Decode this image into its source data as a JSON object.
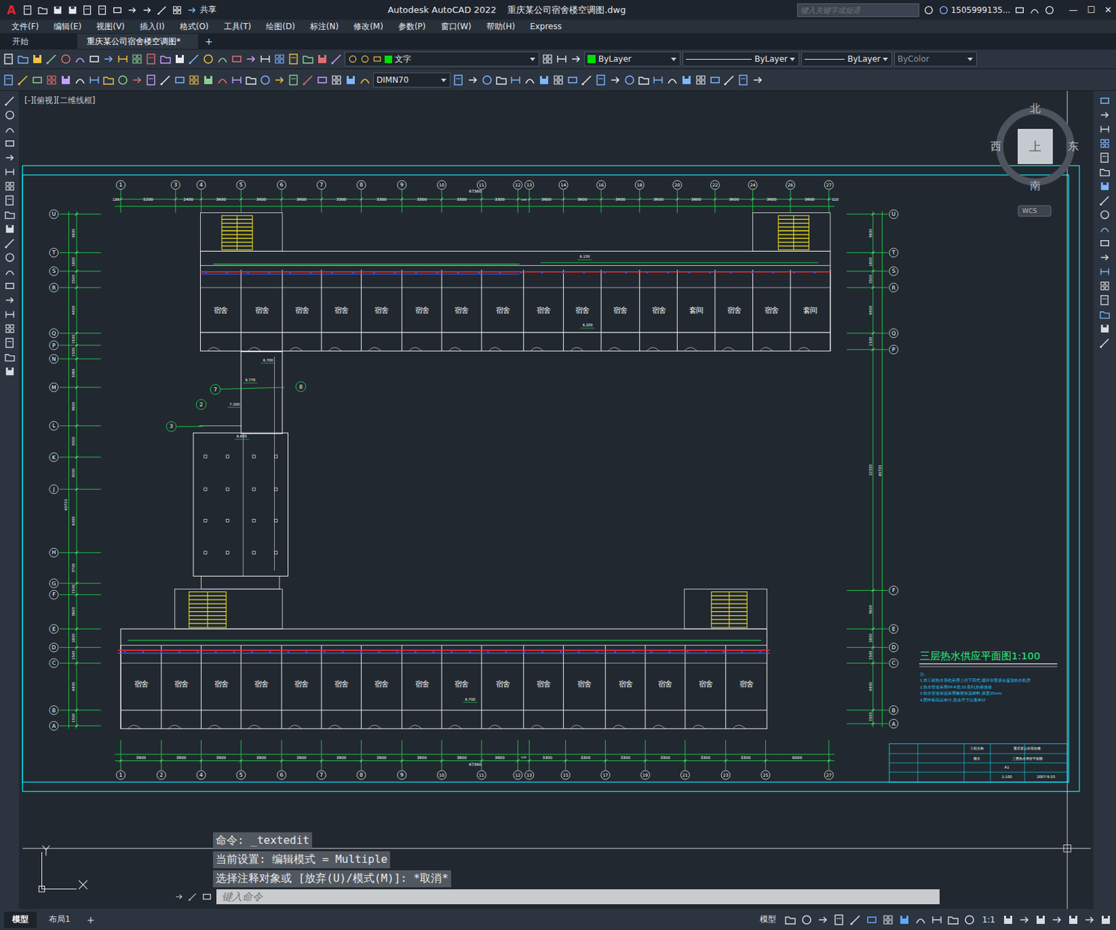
{
  "window": {
    "app_logo": "A",
    "share": "共享",
    "title": "Autodesk AutoCAD 2022    重庆某公司宿舍楼空调图.dwg",
    "search": {
      "placeholder": "键入关键字或短语"
    },
    "user": "1505999135...",
    "controls": [
      "—",
      "☐",
      "✕"
    ]
  },
  "menu": [
    "文件(F)",
    "编辑(E)",
    "视图(V)",
    "插入(I)",
    "格式(O)",
    "工具(T)",
    "绘图(D)",
    "标注(N)",
    "修改(M)",
    "参数(P)",
    "窗口(W)",
    "帮助(H)",
    "Express"
  ],
  "file_tabs": [
    {
      "label": "开始",
      "selected": false
    },
    {
      "label": "重庆某公司宿舍楼空调图*",
      "selected": true
    }
  ],
  "new_tab": "+",
  "toolbar": {
    "layer": "文字",
    "color": "ByLayer",
    "color_swatch": "#00e000",
    "layer_swatch": "#00e000",
    "linetype": "ByLayer",
    "lineweight": "ByLayer",
    "plotstyle": "ByColor",
    "dimstyle": "DIMN70"
  },
  "viewport_label": "[-][俯视][二维线框]",
  "viewcube": {
    "north": "北",
    "south": "南",
    "west": "西",
    "east": "东",
    "top": "上",
    "wcs": "WCS"
  },
  "drawing": {
    "axes_top": [
      "1",
      "3",
      "4",
      "5",
      "6",
      "7",
      "8",
      "9",
      "10",
      "11",
      "12",
      "13",
      "14",
      "16",
      "18",
      "20",
      "22",
      "24",
      "26",
      "27"
    ],
    "dims_top": [
      "5200",
      "2400",
      "3600",
      "3600",
      "3600",
      "3300",
      "3300",
      "3300",
      "3300",
      "3300",
      "120",
      "3600",
      "3600",
      "3600",
      "3600",
      "3600",
      "3600",
      "3600",
      "3600"
    ],
    "edge_top": [
      "120",
      "120"
    ],
    "overall_top": "67360",
    "axes_bottom": [
      "1",
      "2",
      "4",
      "5",
      "6",
      "7",
      "8",
      "9",
      "10",
      "11",
      "12",
      "13",
      "15",
      "17",
      "19",
      "21",
      "23",
      "25",
      "27"
    ],
    "dims_bottom": [
      "3800",
      "3800",
      "3800",
      "3800",
      "3800",
      "3800",
      "3800",
      "3800",
      "3800",
      "3800",
      "120",
      "3300",
      "3300",
      "3300",
      "3300",
      "3300",
      "3300",
      "6000"
    ],
    "overall_bottom": "67360",
    "axes_left": [
      "U",
      "T",
      "S",
      "R",
      "Q",
      "P",
      "N",
      "M",
      "L",
      "K",
      "J",
      "H",
      "G",
      "F",
      "E",
      "D",
      "C",
      "B",
      "A"
    ],
    "dims_left": [
      "3600",
      "1800",
      "1500",
      "4400",
      "1500",
      "1500",
      "3965",
      "3600",
      "3000",
      "3000",
      "6000",
      "3700",
      "1500",
      "3600",
      "1800",
      "1500",
      "4400",
      "1500"
    ],
    "overall_left": "49720",
    "axes_right": [
      "U",
      "T",
      "S",
      "R",
      "Q",
      "P",
      "F",
      "E",
      "D",
      "C",
      "B",
      "A"
    ],
    "dims_right": [
      "3600",
      "1800",
      "1500",
      "4400",
      "1500",
      "22320",
      "3600",
      "1800",
      "1500",
      "4400",
      "1500"
    ],
    "overall_right": "49720",
    "link_axes": [
      "7",
      "8",
      "2",
      "3"
    ],
    "rooms_upper": [
      "宿舍",
      "宿舍",
      "宿舍",
      "宿舍",
      "宿舍",
      "宿舍",
      "宿舍",
      "宿舍",
      "宿舍",
      "宿舍",
      "宿舍",
      "宿舍",
      "套间",
      "宿舍",
      "宿舍",
      "套间"
    ],
    "rooms_lower": [
      "宿舍",
      "宿舍",
      "宿舍",
      "宿舍",
      "宿舍",
      "宿舍",
      "宿舍",
      "宿舍",
      "宿舍",
      "宿舍",
      "宿舍",
      "宿舍",
      "宿舍",
      "宿舍",
      "宿舍",
      "宿舍"
    ],
    "elevations": [
      "6.150",
      "6.200",
      "6.700",
      "6.770",
      "7.300",
      "6.800",
      "6.700"
    ],
    "title": "三层热水供应平面图1:100",
    "notes": [
      "注:",
      "1.本工程热水系统采用上供下回式,循环水泵设在屋顶热水机房",
      "2.热水管道采用PP-R管,S5系列,热熔连接",
      "3.热水管道保温采用橡塑保温材料,厚度25mm",
      "4.图中标高以米计,其余尺寸以毫米计"
    ],
    "title_block": [
      "工程名称",
      "重庆某公司宿舍楼",
      "图名",
      "三层热水供应平面图",
      "A1",
      "1:100",
      "2007-9-25"
    ]
  },
  "command": {
    "history": [
      "命令: _textedit",
      "当前设置: 编辑模式 = Multiple",
      "选择注释对象或 [放弃(U)/模式(M)]: *取消*"
    ],
    "placeholder": "键入命令"
  },
  "layout_tabs": [
    {
      "label": "模型",
      "selected": true
    },
    {
      "label": "布局1",
      "selected": false
    }
  ],
  "add_layout": "+",
  "status_bar": {
    "space": "模型",
    "scale": "1:1"
  }
}
